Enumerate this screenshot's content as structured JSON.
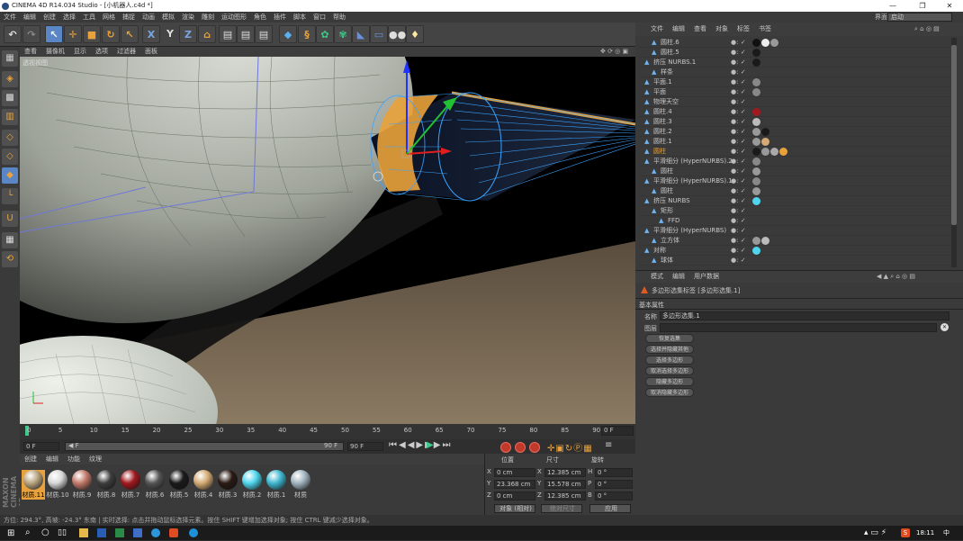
{
  "window": {
    "title": "CINEMA 4D R14.034 Studio - [小机器人.c4d *]",
    "minimize": "—",
    "maximize": "❐",
    "close": "✕"
  },
  "menu": [
    "文件",
    "编辑",
    "创建",
    "选择",
    "工具",
    "网格",
    "捕捉",
    "动画",
    "模拟",
    "渲染",
    "雕刻",
    "运动图形",
    "角色",
    "插件",
    "脚本",
    "窗口",
    "帮助"
  ],
  "layout": {
    "label": "界面:",
    "value": "启动"
  },
  "toolbar": {
    "y_label": "Y",
    "x_label": "X",
    "z_label": "Z"
  },
  "viewport": {
    "menu": [
      "查看",
      "摄像机",
      "显示",
      "选项",
      "过滤器",
      "面板"
    ],
    "view_name": "透视视图"
  },
  "timeline": {
    "ticks": [
      "0",
      "5",
      "10",
      "15",
      "20",
      "25",
      "30",
      "35",
      "40",
      "45",
      "50",
      "55",
      "60",
      "65",
      "70",
      "75",
      "80",
      "85",
      "90"
    ],
    "end_frame": "0 F",
    "current_frame": "0 F",
    "start": "0 F",
    "range_end": "90 F",
    "fps_field": "90 F"
  },
  "material_manager": {
    "menu": [
      "创建",
      "编辑",
      "功能",
      "纹理"
    ],
    "materials": [
      {
        "name": "材质.11",
        "color": "#b9a37e"
      },
      {
        "name": "材质.10",
        "color": "#d8d8d8"
      },
      {
        "name": "材质.9",
        "color": "#c27a6a"
      },
      {
        "name": "材质.8",
        "color": "#3e3e3e"
      },
      {
        "name": "材质.7",
        "color": "#a1191f"
      },
      {
        "name": "材质.6",
        "color": "#555"
      },
      {
        "name": "材质.5",
        "color": "#1a1a1a"
      },
      {
        "name": "材质.4",
        "color": "#d5aa74"
      },
      {
        "name": "材质.3",
        "color": "#2a1a14"
      },
      {
        "name": "材质.2",
        "color": "#4fd6ee"
      },
      {
        "name": "材质.1",
        "color": "#3fb7d0"
      },
      {
        "name": "材质",
        "color": "#a2b4bf"
      }
    ]
  },
  "coords": {
    "headers": [
      "位置",
      "尺寸",
      "旋转"
    ],
    "rows": [
      {
        "axis": "X",
        "pos": "0 cm",
        "size_axis": "X",
        "size": "12.385 cm",
        "rot_axis": "H",
        "rot": "0 °"
      },
      {
        "axis": "Y",
        "pos": "23.368 cm",
        "size_axis": "Y",
        "size": "15.578 cm",
        "rot_axis": "P",
        "rot": "0 °"
      },
      {
        "axis": "Z",
        "pos": "0 cm",
        "size_axis": "Z",
        "size": "12.385 cm",
        "rot_axis": "B",
        "rot": "0 °"
      }
    ],
    "mode": "对象 (相对)",
    "size_mode": "绝对尺寸",
    "apply": "应用"
  },
  "object_manager": {
    "menu": [
      "文件",
      "编辑",
      "查看",
      "对象",
      "标签",
      "书签"
    ],
    "rows": [
      {
        "name": "圆柱.6",
        "indent": 1,
        "tags": [
          "#111",
          "#eee",
          "#999"
        ]
      },
      {
        "name": "圆柱.5",
        "indent": 1,
        "tags": [
          "#1a1a1a"
        ]
      },
      {
        "name": "挤压 NURBS.1",
        "indent": 0,
        "tags": [
          "#1a1a1a"
        ]
      },
      {
        "name": "样条",
        "indent": 1,
        "tags": []
      },
      {
        "name": "平面.1",
        "indent": 0,
        "tags": [
          "#888"
        ]
      },
      {
        "name": "平面",
        "indent": 0,
        "tags": [
          "#888"
        ]
      },
      {
        "name": "物理天空",
        "indent": 0,
        "tags": []
      },
      {
        "name": "圆柱.4",
        "indent": 0,
        "tags": [
          "#a1191f"
        ]
      },
      {
        "name": "圆柱.3",
        "indent": 0,
        "tags": [
          "#bbb"
        ]
      },
      {
        "name": "圆柱.2",
        "indent": 0,
        "tags": [
          "#999",
          "#1a1a1a"
        ]
      },
      {
        "name": "圆柱.1",
        "indent": 0,
        "tags": [
          "#999",
          "#d5aa74"
        ]
      },
      {
        "name": "圆柱",
        "indent": 0,
        "tags": [
          "#1a1a1a",
          "#999",
          "#aaa",
          "#e9a23b"
        ],
        "selected": true
      },
      {
        "name": "平滑细分 (HyperNURBS).2",
        "indent": 0,
        "tags": [
          "#888"
        ]
      },
      {
        "name": "圆柱",
        "indent": 1,
        "tags": [
          "#999"
        ]
      },
      {
        "name": "平滑细分 (HyperNURBS).1",
        "indent": 0,
        "tags": [
          "#888"
        ]
      },
      {
        "name": "圆柱",
        "indent": 1,
        "tags": [
          "#999"
        ]
      },
      {
        "name": "挤压 NURBS",
        "indent": 0,
        "tags": [
          "#4fd6ee"
        ]
      },
      {
        "name": "矩形",
        "indent": 1,
        "tags": []
      },
      {
        "name": "FFD",
        "indent": 2,
        "tags": []
      },
      {
        "name": "平滑细分 (HyperNURBS)",
        "indent": 0,
        "tags": []
      },
      {
        "name": "立方体",
        "indent": 1,
        "tags": [
          "#999",
          "#bbb"
        ]
      },
      {
        "name": "对称",
        "indent": 0,
        "tags": [
          "#4fd6ee"
        ]
      },
      {
        "name": "球体",
        "indent": 1,
        "tags": []
      }
    ]
  },
  "attributes": {
    "menu": [
      "模式",
      "编辑",
      "用户数据"
    ],
    "title": "多边形选集标签 [多边形选集.1]",
    "section": "基本属性",
    "name_label": "名称",
    "name_value": "多边形选集.1",
    "icon_label": "图层",
    "buttons": [
      "恢复选集",
      "选择并隐藏其他",
      "选择多边形",
      "取消选择多边形",
      "隐藏多边形",
      "取消隐藏多边形"
    ]
  },
  "status": "方位: 294.3°, 高坡: -24.3° 东南 | 实时选择: 点击并拖动鼠标选择元素。按住 SHIFT 键增加选择对象; 按住 CTRL 键减少选择对象。",
  "taskbar": {
    "time": "18:11",
    "lang": "中"
  }
}
